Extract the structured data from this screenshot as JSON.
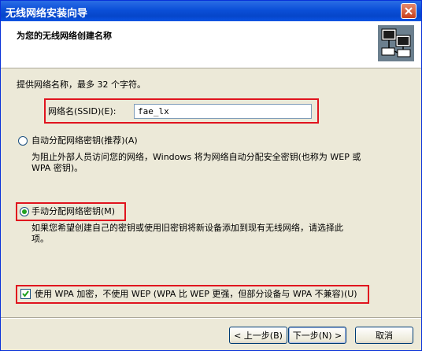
{
  "window": {
    "title": "无线网络安装向导"
  },
  "header": {
    "title": "为您的无线网络创建名称"
  },
  "intro": {
    "text": "提供网络名称，最多 32 个字符。"
  },
  "ssid": {
    "label": "网络名(SSID)(E):",
    "value": "fae_lx"
  },
  "auto_option": {
    "label": "自动分配网络密钥(推荐)(A)",
    "description_line1": "为阻止外部人员访问您的网络，Windows 将为网络自动分配安全密钥(也称为 WEP 或",
    "description_line2": "WPA 密钥)。",
    "selected": false
  },
  "manual_option": {
    "label": "手动分配网络密钥(M)",
    "description_line1": "如果您希望创建自己的密钥或使用旧密钥将新设备添加到现有无线网络，请选择此",
    "description_line2": "项。",
    "selected": true
  },
  "wpa_option": {
    "label": "使用 WPA 加密，不使用 WEP (WPA 比 WEP 更强，但部分设备与 WPA 不兼容)(U)",
    "checked": true
  },
  "buttons": {
    "back": "< 上一步(B)",
    "next": "下一步(N) >",
    "cancel": "取消"
  },
  "colors": {
    "highlight_border": "#e0141e",
    "titlebar": "#0b4fd8",
    "dialog_bg": "#ece9d8"
  },
  "icons": {
    "close": "close-icon",
    "wizard": "network-computers-icon"
  }
}
